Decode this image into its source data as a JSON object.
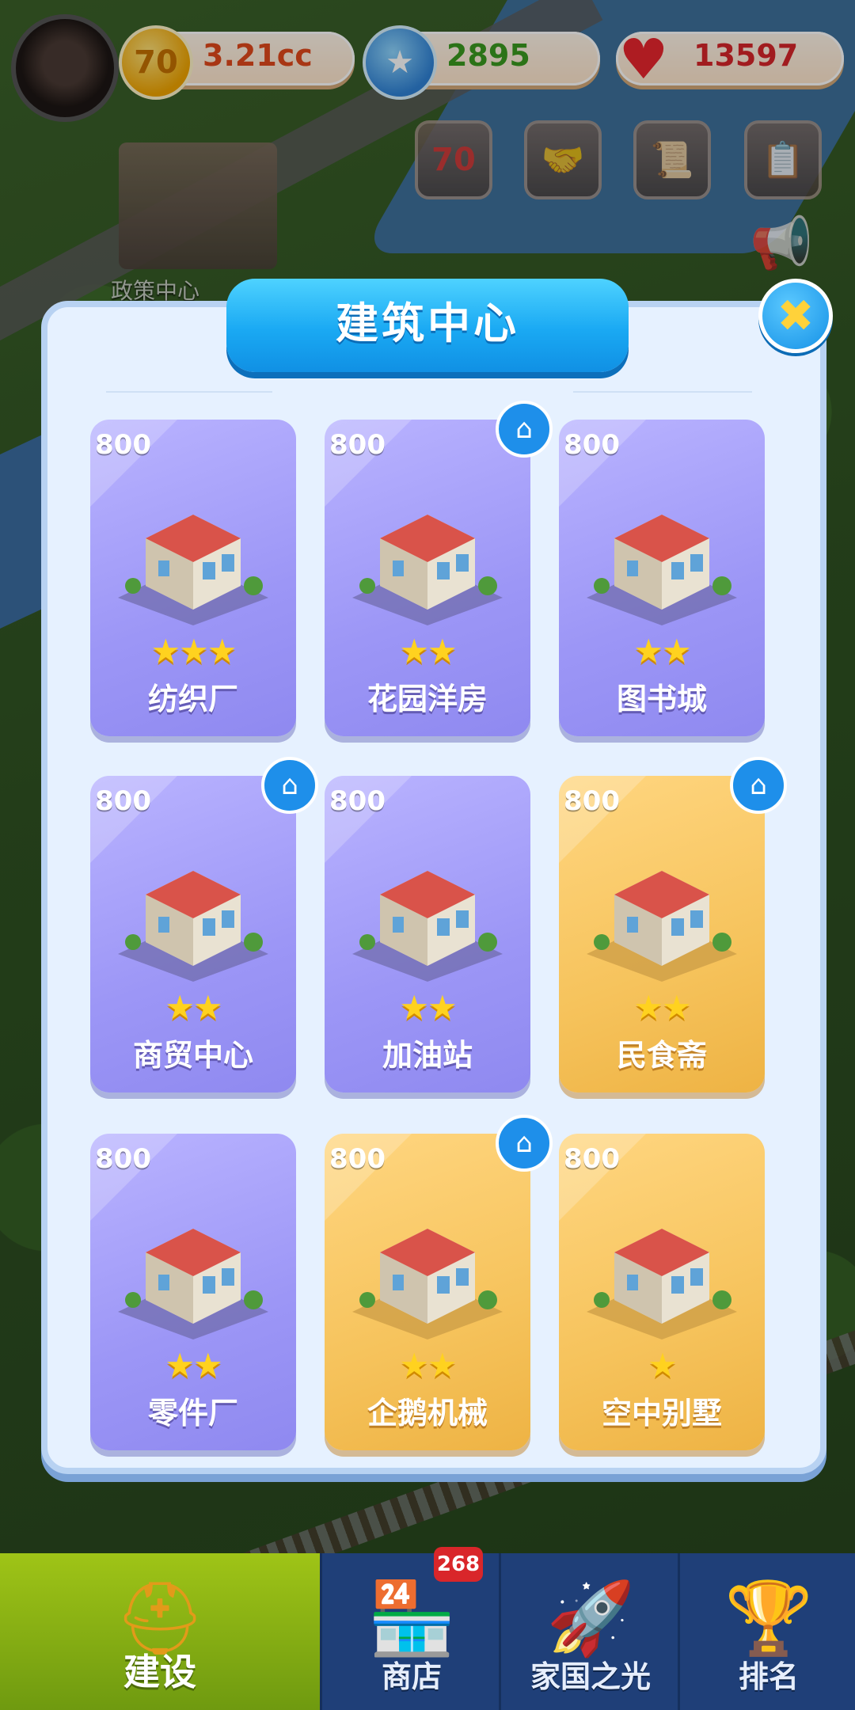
{
  "header": {
    "coin_value": "3.21cc",
    "coin_icon_text": "70",
    "gem_value": "2895",
    "heart_value": "13597"
  },
  "shortcuts": [
    "anniversary-70-icon",
    "handshake-icon",
    "poster-icon",
    "clipboard-icon"
  ],
  "background_label": "政策中心",
  "panel": {
    "title": "建筑中心",
    "close_symbol": "✖"
  },
  "buildings": [
    {
      "price": "800",
      "name": "纺织厂",
      "stars": "★★★",
      "theme": "purple",
      "owned_badge": false,
      "icon": "factory-icon"
    },
    {
      "price": "800",
      "name": "花园洋房",
      "stars": "★★",
      "theme": "purple",
      "owned_badge": true,
      "icon": "house-icon"
    },
    {
      "price": "800",
      "name": "图书城",
      "stars": "★★",
      "theme": "purple",
      "owned_badge": false,
      "icon": "bookstore-icon"
    },
    {
      "price": "800",
      "name": "商贸中心",
      "stars": "★★",
      "theme": "purple",
      "owned_badge": true,
      "icon": "trade-center-icon"
    },
    {
      "price": "800",
      "name": "加油站",
      "stars": "★★",
      "theme": "purple",
      "owned_badge": false,
      "icon": "gas-station-icon"
    },
    {
      "price": "800",
      "name": "民食斋",
      "stars": "★★",
      "theme": "gold",
      "owned_badge": true,
      "icon": "pagoda-restaurant-icon"
    },
    {
      "price": "800",
      "name": "零件厂",
      "stars": "★★",
      "theme": "purple",
      "owned_badge": false,
      "icon": "parts-factory-icon"
    },
    {
      "price": "800",
      "name": "企鹅机械",
      "stars": "★★",
      "theme": "gold",
      "owned_badge": true,
      "icon": "tower-icon"
    },
    {
      "price": "800",
      "name": "空中别墅",
      "stars": "★",
      "theme": "gold",
      "owned_badge": false,
      "icon": "villa-icon"
    }
  ],
  "nav": {
    "badge": "268",
    "items": [
      {
        "label": "建设",
        "icon": "hardhat-icon",
        "active": true
      },
      {
        "label": "商店",
        "icon": "shop-icon",
        "active": false
      },
      {
        "label": "家国之光",
        "icon": "rocket-icon",
        "active": false
      },
      {
        "label": "排名",
        "icon": "podium-icon",
        "active": false
      }
    ]
  },
  "colors": {
    "purple_card": "#9c96f6",
    "gold_card": "#f6c35c",
    "title_blue": "#1aa9f3",
    "nav_bg": "#1f3f78",
    "nav_active": "#8db314"
  }
}
